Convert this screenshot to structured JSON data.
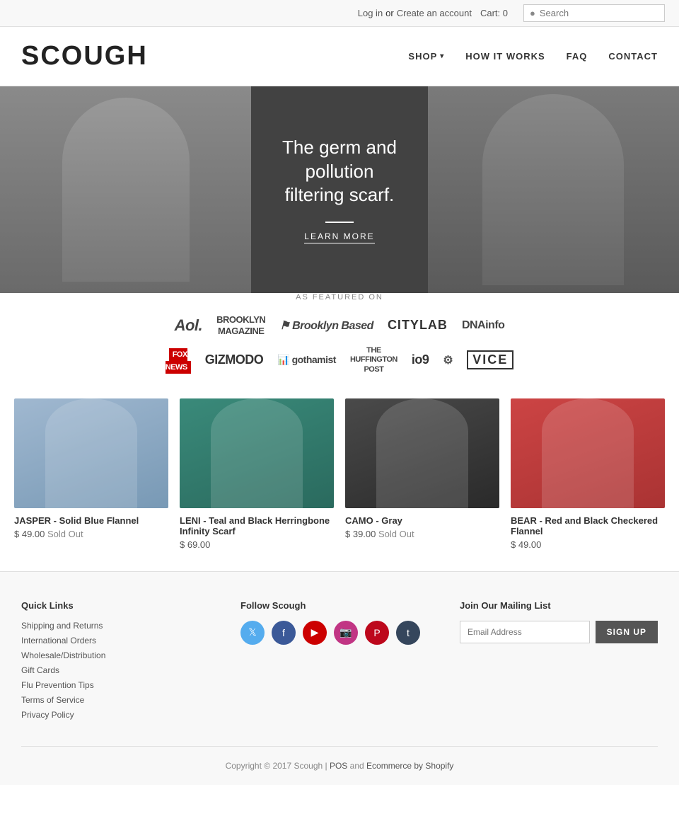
{
  "topbar": {
    "login_label": "Log in",
    "or_text": "or",
    "create_account_label": "Create an account",
    "cart_label": "Cart:",
    "cart_count": "0",
    "search_placeholder": "Search"
  },
  "header": {
    "logo": "SCOUGH",
    "nav": {
      "shop_label": "SHOP",
      "how_it_works_label": "HOW IT WORKS",
      "faq_label": "FAQ",
      "contact_label": "CONTACT"
    }
  },
  "hero": {
    "headline_line1": "The germ and",
    "headline_line2": "pollution",
    "headline_line3": "filtering scarf.",
    "cta_label": "LEARN MORE"
  },
  "featured": {
    "section_label": "AS FEATURED ON",
    "logos_row1": [
      "Aol.",
      "BROOKLYN MAGAZINE",
      "Brooklyn Based",
      "CITYLAB",
      "DNAinfo"
    ],
    "logos_row2": [
      "FOX NEWS",
      "GIZMODO",
      "gothamist",
      "THE HUFFINGTON POST",
      "io9",
      "⚙",
      "VICE"
    ]
  },
  "products": [
    {
      "name": "JASPER - Solid Blue Flannel",
      "price": "$ 49.00",
      "sold_out": true,
      "sold_out_label": "Sold Out",
      "color_class": "product-img-jasper"
    },
    {
      "name": "LENI - Teal and Black Herringbone Infinity Scarf",
      "price": "$ 69.00",
      "sold_out": false,
      "sold_out_label": "",
      "color_class": "product-img-leni"
    },
    {
      "name": "CAMO - Gray",
      "price": "$ 39.00",
      "sold_out": true,
      "sold_out_label": "Sold Out",
      "color_class": "product-img-camo"
    },
    {
      "name": "BEAR - Red and Black Checkered Flannel",
      "price": "$ 49.00",
      "sold_out": false,
      "sold_out_label": "",
      "color_class": "product-img-bear"
    }
  ],
  "footer": {
    "quick_links_title": "Quick Links",
    "quick_links": [
      "Shipping and Returns",
      "International Orders",
      "Wholesale/Distribution",
      "Gift Cards",
      "Flu Prevention Tips",
      "Terms of Service",
      "Privacy Policy"
    ],
    "follow_title": "Follow Scough",
    "mailing_title": "Join Our Mailing List",
    "email_placeholder": "Email Address",
    "signup_label": "SIGN UP",
    "copyright": "Copyright © 2017 Scough |",
    "pos_label": "POS",
    "and_text": "and",
    "ecommerce_label": "Ecommerce by Shopify"
  }
}
